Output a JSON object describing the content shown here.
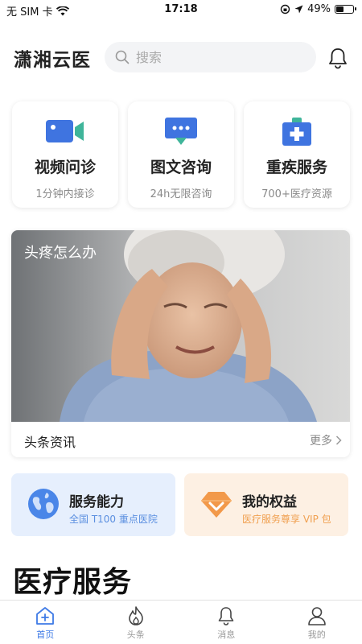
{
  "status_bar": {
    "carrier": "无 SIM 卡",
    "time": "17:18",
    "battery": "49%",
    "battery_level": 0.49
  },
  "header": {
    "app_title": "潇湘云医",
    "search_placeholder": "搜索"
  },
  "services": [
    {
      "title": "视频问诊",
      "subtitle": "1分钟内接诊",
      "icon": "video-camera-icon"
    },
    {
      "title": "图文咨询",
      "subtitle": "24h无限咨询",
      "icon": "chat-bubble-icon"
    },
    {
      "title": "重疾服务",
      "subtitle": "700+医疗资源",
      "icon": "medical-kit-icon"
    }
  ],
  "news": {
    "caption": "头疼怎么办",
    "label": "头条资讯",
    "more": "更多"
  },
  "promos": [
    {
      "title": "服务能力",
      "subtitle": "全国 T100 重点医院",
      "icon": "globe-icon"
    },
    {
      "title": "我的权益",
      "subtitle": "医疗服务尊享 VIP 包",
      "icon": "diamond-icon"
    }
  ],
  "section_title": "医疗服务",
  "tabs": [
    {
      "label": "首页",
      "icon": "home-icon",
      "active": true
    },
    {
      "label": "头条",
      "icon": "flame-icon",
      "active": false
    },
    {
      "label": "消息",
      "icon": "bell-icon",
      "active": false
    },
    {
      "label": "我的",
      "icon": "user-icon",
      "active": false
    }
  ],
  "colors": {
    "accent": "#3e7ae6",
    "promo_blue_bg": "#e6effd",
    "promo_orange_bg": "#fdf0e3",
    "medical_teal": "#2ea7a0"
  }
}
